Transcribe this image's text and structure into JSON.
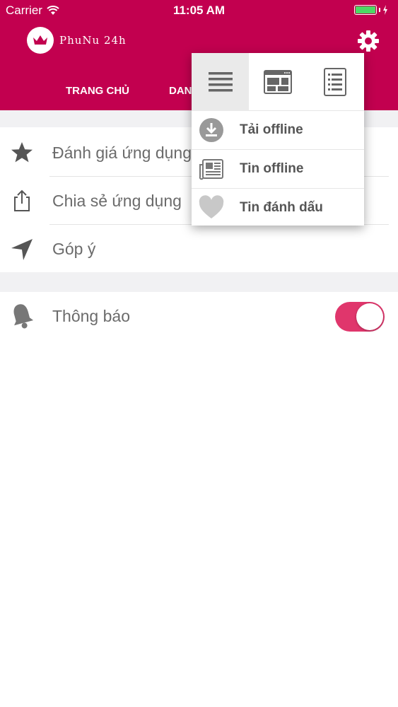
{
  "status_bar": {
    "carrier": "Carrier",
    "time": "11:05 AM"
  },
  "header": {
    "brand": "PhuNu 24h",
    "tabs": [
      "TRANG CHỦ",
      "DAN"
    ],
    "brand_color": "#c2004f"
  },
  "settings": {
    "items": [
      {
        "label": "Đánh giá ứng dụng",
        "icon": "star-icon"
      },
      {
        "label": "Chia sẻ ứng dụng",
        "icon": "share-icon"
      },
      {
        "label": "Góp ý",
        "icon": "send-arrow-icon"
      }
    ],
    "notification": {
      "label": "Thông báo",
      "icon": "bell-icon",
      "enabled": true,
      "accent": "#e0366c"
    }
  },
  "popup": {
    "view_modes": [
      "list-view-icon",
      "grid-view-icon",
      "detail-view-icon"
    ],
    "active_view": 0,
    "items": [
      {
        "label": "Tải offline",
        "icon": "download-icon"
      },
      {
        "label": "Tin offline",
        "icon": "newspaper-icon"
      },
      {
        "label": "Tin đánh dấu",
        "icon": "heart-icon"
      }
    ]
  }
}
